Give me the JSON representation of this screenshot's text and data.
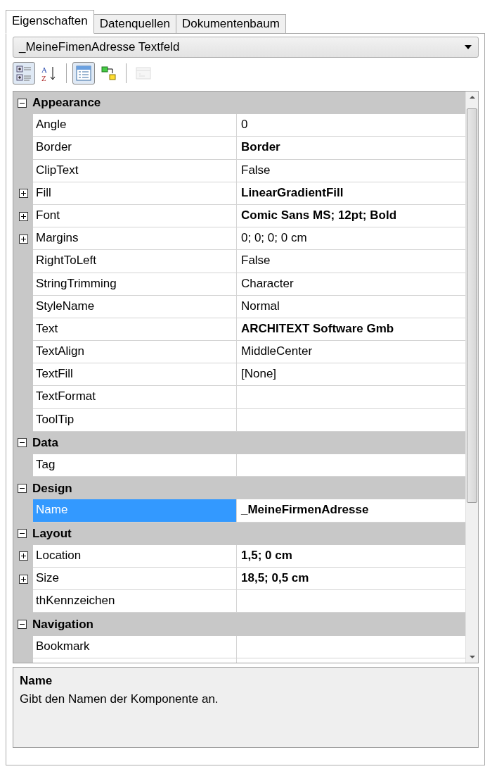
{
  "tabs": [
    {
      "label": "Eigenschaften",
      "selected": true
    },
    {
      "label": "Datenquellen",
      "selected": false
    },
    {
      "label": "Dokumentenbaum",
      "selected": false
    }
  ],
  "object_selector": {
    "value": "_MeineFimenAdresse Textfeld"
  },
  "toolbar": [
    {
      "kind": "categorized",
      "selected": true,
      "disabled": false
    },
    {
      "kind": "alphabetical",
      "selected": false,
      "disabled": false,
      "glyphs": [
        "A",
        "Z"
      ]
    },
    {
      "kind": "separator"
    },
    {
      "kind": "properties",
      "selected": true,
      "disabled": false
    },
    {
      "kind": "events",
      "selected": false,
      "disabled": false
    },
    {
      "kind": "separator"
    },
    {
      "kind": "property_pages",
      "selected": false,
      "disabled": true
    }
  ],
  "categories": [
    {
      "name": "Appearance",
      "expanded": true,
      "properties": [
        {
          "name": "Angle",
          "value": "0",
          "modified": false,
          "expandable": false,
          "selected": false
        },
        {
          "name": "Border",
          "value": "Border",
          "modified": true,
          "expandable": false,
          "selected": false
        },
        {
          "name": "ClipText",
          "value": "False",
          "modified": false,
          "expandable": false,
          "selected": false
        },
        {
          "name": "Fill",
          "value": "LinearGradientFill",
          "modified": true,
          "expandable": true,
          "selected": false
        },
        {
          "name": "Font",
          "value": "Comic Sans MS; 12pt; Bold",
          "modified": true,
          "expandable": true,
          "selected": false
        },
        {
          "name": "Margins",
          "value": "0; 0; 0; 0 cm",
          "modified": false,
          "expandable": true,
          "selected": false
        },
        {
          "name": "RightToLeft",
          "value": "False",
          "modified": false,
          "expandable": false,
          "selected": false
        },
        {
          "name": "StringTrimming",
          "value": "Character",
          "modified": false,
          "expandable": false,
          "selected": false
        },
        {
          "name": "StyleName",
          "value": "Normal",
          "modified": false,
          "expandable": false,
          "selected": false
        },
        {
          "name": "Text",
          "value": "ARCHITEXT Software Gmb",
          "modified": true,
          "expandable": false,
          "selected": false
        },
        {
          "name": "TextAlign",
          "value": "MiddleCenter",
          "modified": false,
          "expandable": false,
          "selected": false
        },
        {
          "name": "TextFill",
          "value": "[None]",
          "modified": false,
          "expandable": false,
          "selected": false
        },
        {
          "name": "TextFormat",
          "expandable": false,
          "selected": false
        },
        {
          "name": "ToolTip",
          "expandable": false,
          "selected": false
        }
      ]
    },
    {
      "name": "Data",
      "expanded": true,
      "properties": [
        {
          "name": "Tag",
          "expandable": false,
          "selected": false
        }
      ]
    },
    {
      "name": "Design",
      "expanded": true,
      "properties": [
        {
          "name": "Name",
          "value": "_MeineFirmenAdresse",
          "modified": true,
          "expandable": false,
          "selected": true
        }
      ]
    },
    {
      "name": "Layout",
      "expanded": true,
      "properties": [
        {
          "name": "Location",
          "value": "1,5; 0 cm",
          "modified": true,
          "expandable": true,
          "selected": false
        },
        {
          "name": "Size",
          "value": "18,5; 0,5 cm",
          "modified": true,
          "expandable": true,
          "selected": false
        },
        {
          "name": "thKennzeichen",
          "expandable": false,
          "selected": false
        }
      ]
    },
    {
      "name": "Navigation",
      "expanded": true,
      "properties": [
        {
          "name": "Bookmark",
          "expandable": false,
          "selected": false
        }
      ]
    }
  ],
  "description": {
    "title": "Name",
    "text": "Gibt den Namen der Komponente an."
  }
}
